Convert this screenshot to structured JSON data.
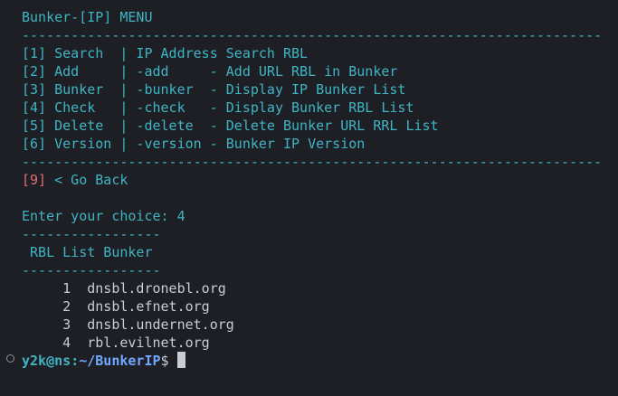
{
  "terminal": {
    "menu_title": "Bunker-[IP] MENU",
    "separator": "-----------------------------------------------------------------------",
    "menu_items": [
      {
        "key": "[1]",
        "label": " Search  | IP Address Search RBL"
      },
      {
        "key": "[2]",
        "label": " Add     | -add     - Add URL RBL in Bunker"
      },
      {
        "key": "[3]",
        "label": " Bunker  | -bunker  - Display IP Bunker List"
      },
      {
        "key": "[4]",
        "label": " Check   | -check   - Display Bunker RBL List"
      },
      {
        "key": "[5]",
        "label": " Delete  | -delete  - Delete Bunker URL RRL List"
      },
      {
        "key": "[6]",
        "label": " Version | -version - Bunker IP Version"
      }
    ],
    "back_key": "[9]",
    "back_label": " < Go Back",
    "choice_prompt": "Enter your choice: 4",
    "short_separator": "-----------------",
    "list_title": " RBL List Bunker",
    "rbl_list": [
      {
        "num": "     1",
        "host": "  dnsbl.dronebl.org"
      },
      {
        "num": "     2",
        "host": "  dnsbl.efnet.org"
      },
      {
        "num": "     3",
        "host": "  dnsbl.undernet.org"
      },
      {
        "num": "     4",
        "host": "  rbl.evilnet.org"
      }
    ],
    "shell_prompt": {
      "user_host": "y2k@ns",
      "sep": ":",
      "path": "~/BunkerIP",
      "sign": "$"
    },
    "colors": {
      "background": "#1e1f25",
      "accent_cyan": "#3fb5c4",
      "accent_red": "#e06c75",
      "path_blue": "#6fa8ff",
      "text": "#c9ccd4"
    },
    "icons": [
      "terminal-status-circle-icon",
      "block-cursor-icon"
    ]
  }
}
